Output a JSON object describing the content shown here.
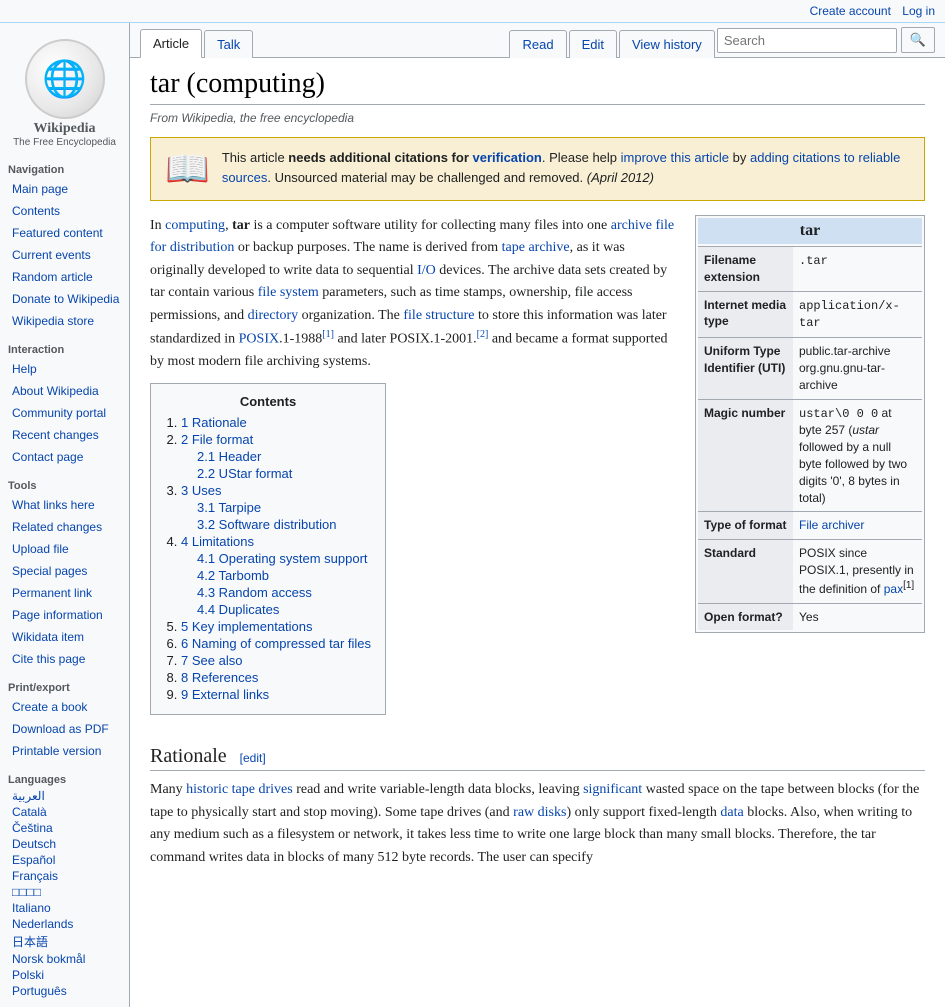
{
  "topbar": {
    "create_account": "Create account",
    "log_in": "Log in"
  },
  "sidebar": {
    "logo_emoji": "🌐",
    "wiki_name": "Wikipedia",
    "wiki_sub": "The Free Encyclopedia",
    "navigation": {
      "title": "Navigation",
      "items": [
        {
          "label": "Main page",
          "href": "#"
        },
        {
          "label": "Contents",
          "href": "#"
        },
        {
          "label": "Featured content",
          "href": "#"
        },
        {
          "label": "Current events",
          "href": "#"
        },
        {
          "label": "Random article",
          "href": "#"
        },
        {
          "label": "Donate to Wikipedia",
          "href": "#"
        },
        {
          "label": "Wikipedia store",
          "href": "#"
        }
      ]
    },
    "interaction": {
      "title": "Interaction",
      "items": [
        {
          "label": "Help",
          "href": "#"
        },
        {
          "label": "About Wikipedia",
          "href": "#"
        },
        {
          "label": "Community portal",
          "href": "#"
        },
        {
          "label": "Recent changes",
          "href": "#"
        },
        {
          "label": "Contact page",
          "href": "#"
        }
      ]
    },
    "tools": {
      "title": "Tools",
      "items": [
        {
          "label": "What links here",
          "href": "#"
        },
        {
          "label": "Related changes",
          "href": "#"
        },
        {
          "label": "Upload file",
          "href": "#"
        },
        {
          "label": "Special pages",
          "href": "#"
        },
        {
          "label": "Permanent link",
          "href": "#"
        },
        {
          "label": "Page information",
          "href": "#"
        },
        {
          "label": "Wikidata item",
          "href": "#"
        },
        {
          "label": "Cite this page",
          "href": "#"
        }
      ]
    },
    "print": {
      "title": "Print/export",
      "items": [
        {
          "label": "Create a book",
          "href": "#"
        },
        {
          "label": "Download as PDF",
          "href": "#"
        },
        {
          "label": "Printable version",
          "href": "#"
        }
      ]
    },
    "languages": {
      "title": "Languages",
      "items": [
        {
          "label": "العربية",
          "href": "#"
        },
        {
          "label": "Català",
          "href": "#"
        },
        {
          "label": "Čeština",
          "href": "#"
        },
        {
          "label": "Deutsch",
          "href": "#"
        },
        {
          "label": "Español",
          "href": "#"
        },
        {
          "label": "Français",
          "href": "#"
        },
        {
          "label": "□□□□",
          "href": "#"
        },
        {
          "label": "Italiano",
          "href": "#"
        },
        {
          "label": "Nederlands",
          "href": "#"
        },
        {
          "label": "日本語",
          "href": "#"
        },
        {
          "label": "Norsk bokmål",
          "href": "#"
        },
        {
          "label": "Polski",
          "href": "#"
        },
        {
          "label": "Português",
          "href": "#"
        }
      ]
    }
  },
  "tabs": {
    "article": "Article",
    "talk": "Talk",
    "read": "Read",
    "edit": "Edit",
    "view_history": "View history"
  },
  "search": {
    "placeholder": "Search",
    "button": "🔍"
  },
  "article": {
    "title": "tar (computing)",
    "from_wiki": "From Wikipedia, the free encyclopedia",
    "notice": {
      "icon": "📖",
      "text_parts": [
        "This article ",
        "needs additional citations for ",
        "verification",
        ". Please help ",
        "improve this article",
        " by adding citations to reliable sources",
        ". Unsourced material may be challenged and removed. ",
        "(April 2012)"
      ]
    },
    "infobox": {
      "title": "tar",
      "rows": [
        {
          "label": "Filename extension",
          "value": ".tar"
        },
        {
          "label": "Internet media type",
          "value": "application/x-tar"
        },
        {
          "label": "Uniform Type Identifier (UTI)",
          "value": "public.tar-archive org.gnu.gnu-tar-archive"
        },
        {
          "label": "Magic number",
          "value": "ustar\\0 0 0 at byte 257 (ustar followed by a null byte followed by two digits '0', 8 bytes in total)"
        },
        {
          "label": "Type of format",
          "value": "File archiver"
        },
        {
          "label": "Standard",
          "value": "POSIX since POSIX.1, presently in the definition of pax[1]"
        },
        {
          "label": "Open format?",
          "value": "Yes"
        }
      ]
    },
    "intro": "In computing, tar is a computer software utility for collecting many files into one archive file for distribution or backup purposes. The name is derived from tape archive, as it was originally developed to write data to sequential I/O devices. The archive data sets created by tar contain various file system parameters, such as time stamps, ownership, file access permissions, and directory organization. The file structure to store this information was later standardized in POSIX.1-1988[1] and later POSIX.1-2001.[2] and became a format supported by most modern file archiving systems.",
    "toc": {
      "title": "Contents",
      "items": [
        {
          "num": "1",
          "label": "Rationale",
          "sub": []
        },
        {
          "num": "2",
          "label": "File format",
          "sub": [
            {
              "num": "2.1",
              "label": "Header"
            },
            {
              "num": "2.2",
              "label": "UStar format"
            }
          ]
        },
        {
          "num": "3",
          "label": "Uses",
          "sub": [
            {
              "num": "3.1",
              "label": "Tarpipe"
            },
            {
              "num": "3.2",
              "label": "Software distribution"
            }
          ]
        },
        {
          "num": "4",
          "label": "Limitations",
          "sub": [
            {
              "num": "4.1",
              "label": "Operating system support"
            },
            {
              "num": "4.2",
              "label": "Tarbomb"
            },
            {
              "num": "4.3",
              "label": "Random access"
            },
            {
              "num": "4.4",
              "label": "Duplicates"
            }
          ]
        },
        {
          "num": "5",
          "label": "Key implementations",
          "sub": []
        },
        {
          "num": "6",
          "label": "Naming of compressed tar files",
          "sub": []
        },
        {
          "num": "7",
          "label": "See also",
          "sub": []
        },
        {
          "num": "8",
          "label": "References",
          "sub": []
        },
        {
          "num": "9",
          "label": "External links",
          "sub": []
        }
      ]
    },
    "rationale_heading": "Rationale",
    "rationale_edit": "[edit]",
    "rationale_text": "Many historic tape drives read and write variable-length data blocks, leaving significant wasted space on the tape between blocks (for the tape to physically start and stop moving). Some tape drives (and raw disks) only support fixed-length data blocks. Also, when writing to any medium such as a filesystem or network, it takes less time to write one large block than many small blocks. Therefore, the tar command writes data in blocks of many 512 byte records. The user can specify"
  }
}
